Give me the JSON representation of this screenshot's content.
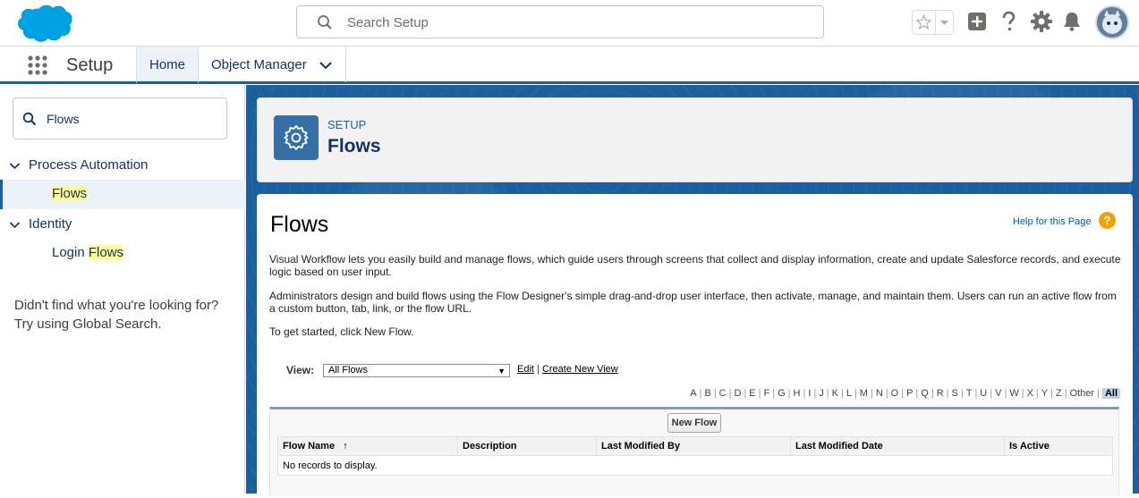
{
  "header": {
    "search_placeholder": "Search Setup",
    "brand_color": "#00a1e0"
  },
  "nav": {
    "app_name": "Setup",
    "tabs": [
      {
        "label": "Home",
        "active": true
      },
      {
        "label": "Object Manager",
        "active": false
      }
    ]
  },
  "sidebar": {
    "quickfind_value": "Flows",
    "groups": [
      {
        "label": "Process Automation",
        "items": [
          {
            "label_highlight": "Flows",
            "selected": true
          }
        ]
      },
      {
        "label": "Identity",
        "items": [
          {
            "label_prefix": "Login ",
            "label_highlight": "Flows",
            "selected": false
          }
        ]
      }
    ],
    "not_found_text": "Didn't find what you're looking for? Try using Global Search."
  },
  "page_header": {
    "eyebrow": "SETUP",
    "title": "Flows"
  },
  "content": {
    "title": "Flows",
    "help_link": "Help for this Page",
    "help_icon": "?",
    "paragraphs": [
      "Visual Workflow lets you easily build and manage flows, which guide users through screens that collect and display information, create and update Salesforce records, and execute logic based on user input.",
      "Administrators design and build flows using the Flow Designer's simple drag-and-drop user interface, then activate, manage, and maintain them. Users can run an active flow from a custom button, tab, link, or the flow URL.",
      "To get started, click New Flow."
    ],
    "view_label": "View:",
    "view_selected": "All Flows",
    "edit_link": "Edit",
    "link_separator": "|",
    "create_view_link": "Create New View",
    "alphabet": [
      "A",
      "B",
      "C",
      "D",
      "E",
      "F",
      "G",
      "H",
      "I",
      "J",
      "K",
      "L",
      "M",
      "N",
      "O",
      "P",
      "Q",
      "R",
      "S",
      "T",
      "U",
      "V",
      "W",
      "X",
      "Y",
      "Z",
      "Other",
      "All"
    ],
    "new_flow_button": "New Flow",
    "columns": [
      "Flow Name",
      "Description",
      "Last Modified By",
      "Last Modified Date",
      "Is Active"
    ],
    "sort_indicator": "↑",
    "empty_message": "No records to display."
  }
}
